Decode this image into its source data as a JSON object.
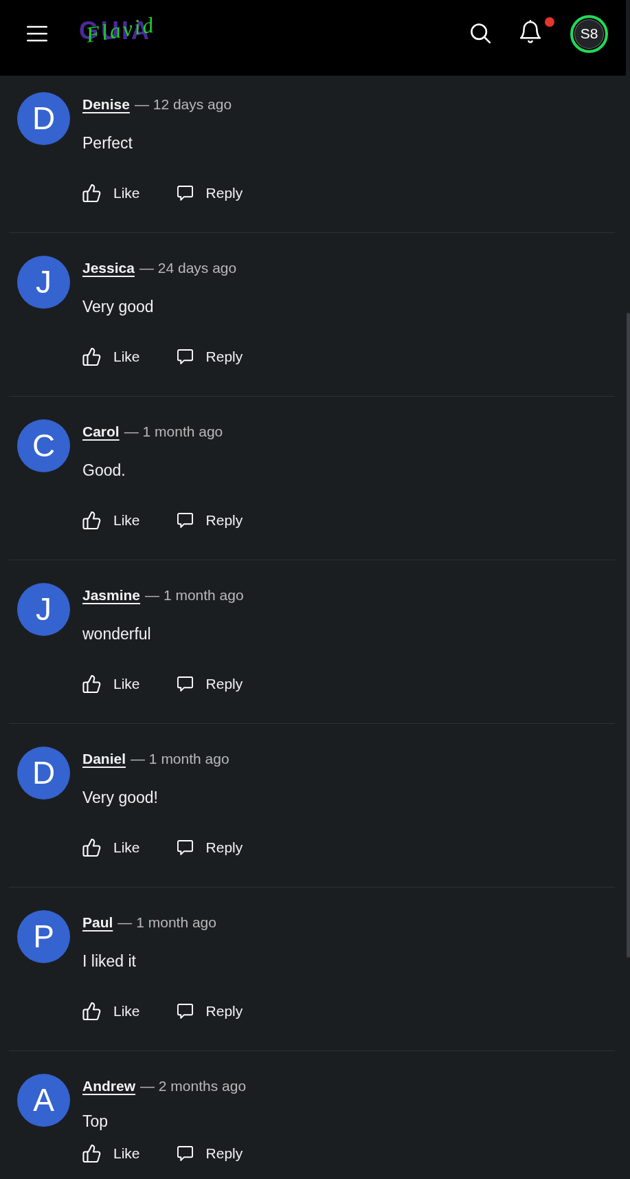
{
  "header": {
    "logo": {
      "back_text": "GUIA",
      "script_text": "Flavid"
    },
    "notifications": {
      "unread": true
    },
    "profile": {
      "initials": "S8"
    }
  },
  "comments": [
    {
      "initial": "D",
      "author": "Denise",
      "time": "— 12 days ago",
      "text": "Perfect",
      "actions": [
        {
          "kind": "like",
          "label": "Like"
        },
        {
          "kind": "reply",
          "label": "Reply"
        }
      ]
    },
    {
      "initial": "J",
      "author": "Jessica",
      "time": "— 24 days ago",
      "text": "Very good",
      "actions": [
        {
          "kind": "like",
          "label": "Like"
        },
        {
          "kind": "reply",
          "label": "Reply"
        }
      ]
    },
    {
      "initial": "C",
      "author": "Carol",
      "time": "— 1 month ago",
      "text": "Good.",
      "actions": [
        {
          "kind": "like",
          "label": "Like"
        },
        {
          "kind": "reply",
          "label": "Reply"
        }
      ]
    },
    {
      "initial": "J",
      "author": "Jasmine",
      "time": "— 1 month ago",
      "text": "wonderful",
      "actions": [
        {
          "kind": "like",
          "label": "Like"
        },
        {
          "kind": "reply",
          "label": "Reply"
        }
      ]
    },
    {
      "initial": "D",
      "author": "Daniel",
      "time": "— 1 month ago",
      "text": "Very good!",
      "actions": [
        {
          "kind": "like",
          "label": "Like"
        },
        {
          "kind": "reply",
          "label": "Reply"
        }
      ]
    },
    {
      "initial": "P",
      "author": "Paul",
      "time": "— 1 month ago",
      "text": "I liked it",
      "actions": [
        {
          "kind": "like",
          "label": "Like"
        },
        {
          "kind": "reply",
          "label": "Reply"
        }
      ]
    },
    {
      "initial": "A",
      "author": "Andrew",
      "time": "— 2 months ago",
      "text": "Top",
      "actions": [
        {
          "kind": "like",
          "label": "Like"
        },
        {
          "kind": "reply",
          "label": "Reply"
        }
      ]
    }
  ]
}
